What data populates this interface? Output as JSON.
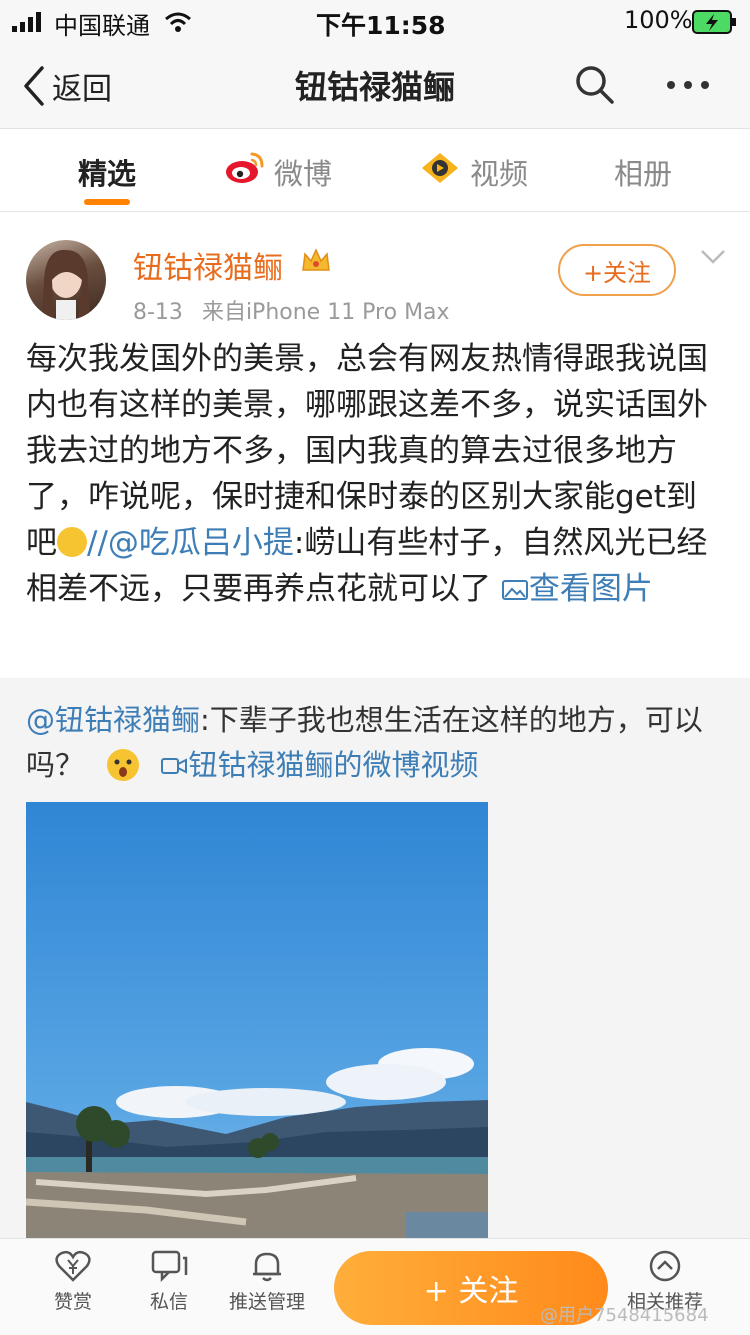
{
  "status_bar": {
    "carrier": "中国联通",
    "time": "下午11:58",
    "battery": "100%"
  },
  "nav": {
    "back_label": "返回",
    "title": "钮钴禄猫鲡"
  },
  "tabs": [
    {
      "label": "精选",
      "active": true
    },
    {
      "label": "微博",
      "active": false
    },
    {
      "label": "视频",
      "active": false
    },
    {
      "label": "相册",
      "active": false
    }
  ],
  "post": {
    "author": "钮钴禄猫鲡",
    "date": "8-13",
    "source": "来自iPhone 11 Pro Max",
    "follow_label": "+关注",
    "text_main": "每次我发国外的美景，总会有网友热情得跟我说国内也有这样的美景，哪哪跟这差不多，说实话国外我去过的地方不多，国内我真的算去过很多地方了，咋说呢，保时捷和保时泰的区别大家能get到吧",
    "repost_sep": "//",
    "mention_user": "@吃瓜吕小提",
    "text_after_mention": ":崂山有些村子，自然风光已经相差不远，只要再养点花就可以了",
    "view_image_label": "查看图片"
  },
  "repost": {
    "mention": "@钮钴禄猫鲡",
    "text": ":下辈子我也想生活在这样的地方，可以吗？",
    "video_link": "钮钴禄猫鲡的微博视频"
  },
  "bottom_bar": {
    "reward_label": "赞赏",
    "message_label": "私信",
    "push_label": "推送管理",
    "follow_label": "+ 关注",
    "related_label": "相关推荐",
    "watermark": "@用户7548415684"
  },
  "colors": {
    "accent": "#ff8200",
    "author": "#e86c1e",
    "link": "#3e7eb6"
  }
}
